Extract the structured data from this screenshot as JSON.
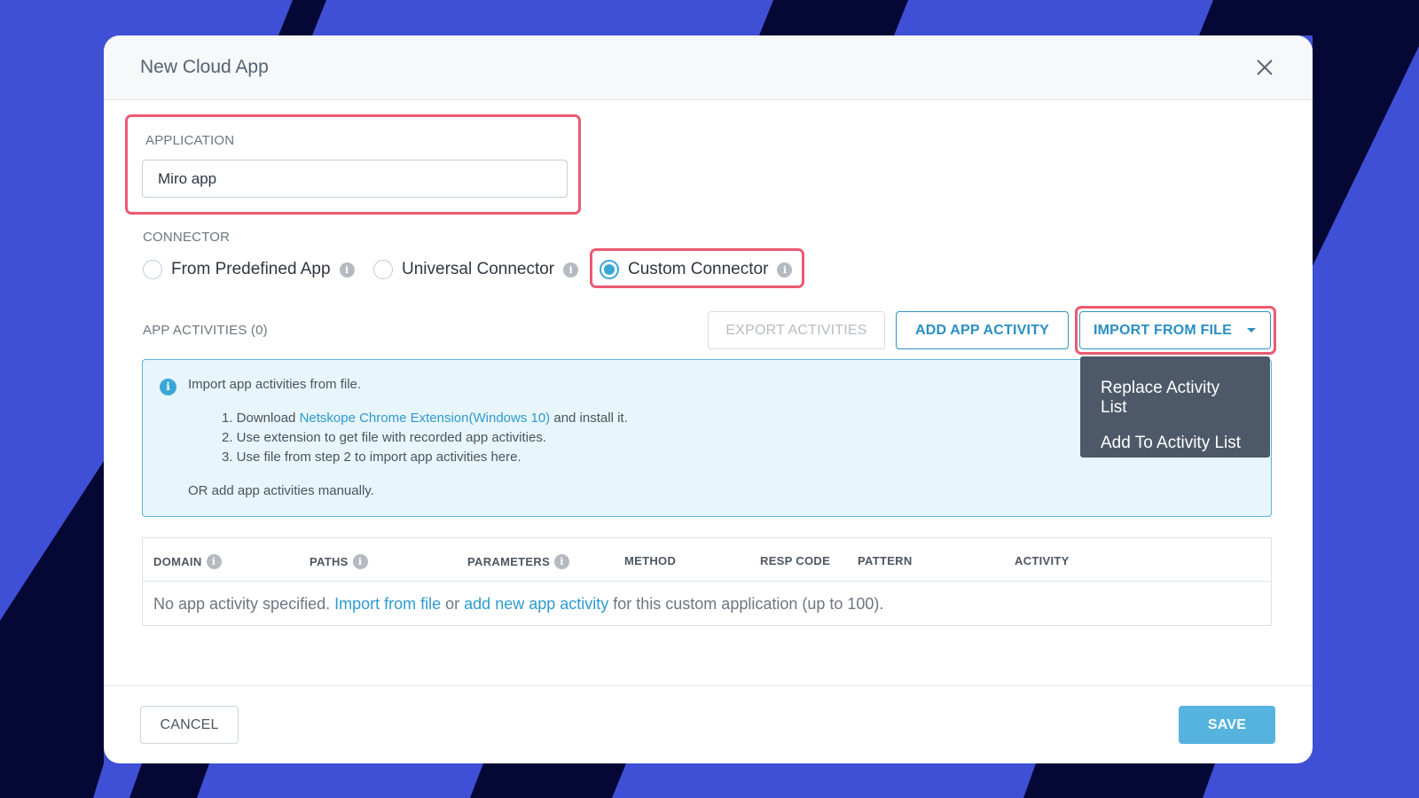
{
  "modal": {
    "title": "New Cloud App"
  },
  "application": {
    "label": "APPLICATION",
    "value": "Miro app"
  },
  "connector": {
    "label": "CONNECTOR",
    "options": [
      {
        "label": "From Predefined App",
        "checked": false
      },
      {
        "label": "Universal Connector",
        "checked": false
      },
      {
        "label": "Custom Connector",
        "checked": true
      }
    ]
  },
  "activities": {
    "label": "APP ACTIVITIES (0)",
    "export_label": "EXPORT ACTIVITIES",
    "add_label": "ADD APP ACTIVITY",
    "import_label": "IMPORT FROM FILE",
    "dropdown": [
      "Replace Activity List",
      "Add To Activity List"
    ]
  },
  "info": {
    "title": "Import app activities from file.",
    "step1_prefix": "1. Download ",
    "step1_link": "Netskope Chrome Extension(Windows 10)",
    "step1_suffix": " and install it.",
    "step2": "2. Use extension to get file with recorded app activities.",
    "step3": "3. Use file from step 2 to import app activities here.",
    "or_text": "OR add app activities manually."
  },
  "table": {
    "columns": [
      "DOMAIN",
      "PATHS",
      "PARAMETERS",
      "METHOD",
      "RESP CODE",
      "PATTERN",
      "ACTIVITY"
    ],
    "empty_prefix": "No app activity specified. ",
    "empty_link1": "Import from file",
    "empty_mid": " or ",
    "empty_link2": "add new app activity",
    "empty_suffix": " for this custom application (up to 100)."
  },
  "footer": {
    "cancel_label": "CANCEL",
    "save_label": "SAVE"
  },
  "colors": {
    "accent": "#3aa6d8",
    "highlight": "#ec5a72",
    "background": "#3f4fd6",
    "dark_stripe": "#050834"
  }
}
